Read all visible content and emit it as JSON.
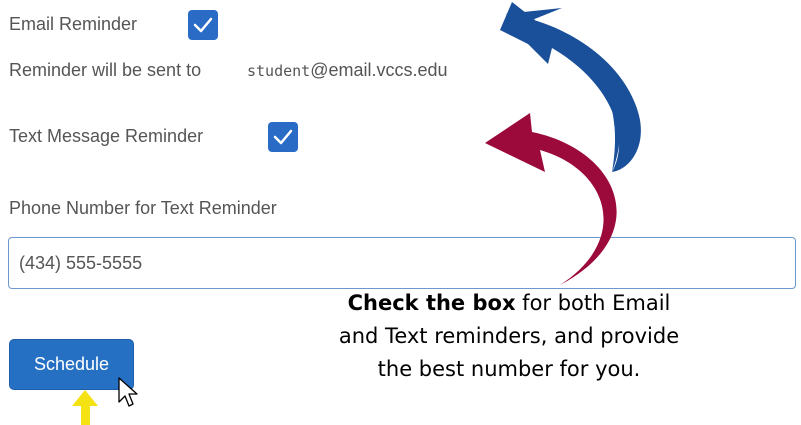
{
  "email_reminder": {
    "label": "Email Reminder",
    "checked": true,
    "sent_to_label": "Reminder will be sent to",
    "email_user": "student",
    "email_domain": "@email.vccs.edu"
  },
  "text_reminder": {
    "label": "Text Message Reminder",
    "checked": true
  },
  "phone": {
    "label": "Phone Number for Text Reminder",
    "value": "(434) 555-5555"
  },
  "schedule_button": {
    "label": "Schedule"
  },
  "annotation": {
    "bold": "Check the box",
    "rest_line1": " for both Email",
    "line2": "and Text reminders, and provide",
    "line3": "the best number for you."
  },
  "colors": {
    "checkbox": "#2a6cc5",
    "button": "#2670c4",
    "arrow_blue": "#1a4f9a",
    "arrow_red": "#9b0a3a",
    "arrow_yellow": "#f4e213"
  },
  "icons": [
    "checkmark-icon",
    "mouse-cursor-icon",
    "curved-arrow-blue",
    "curved-arrow-red",
    "yellow-up-arrow-icon"
  ]
}
